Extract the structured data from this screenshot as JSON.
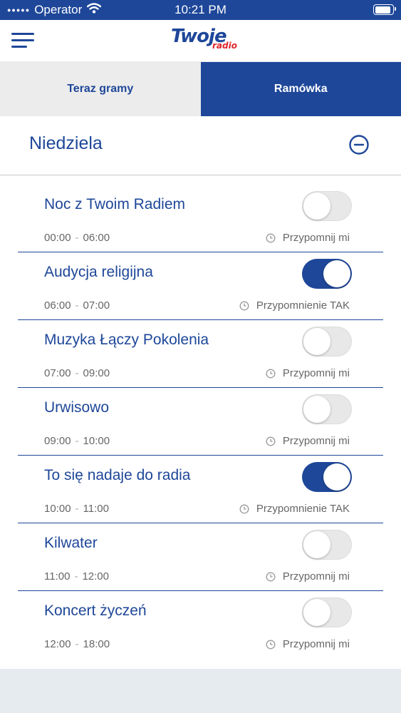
{
  "status_bar": {
    "carrier": "Operator",
    "time": "10:21 PM"
  },
  "header": {
    "logo_main": "Twoje",
    "logo_sub": "radio"
  },
  "tabs": [
    {
      "label": "Teraz gramy",
      "active": false
    },
    {
      "label": "Ramówka",
      "active": true
    }
  ],
  "day": {
    "title": "Niedziela"
  },
  "programs": [
    {
      "title": "Noc z Twoim Radiem",
      "start": "00:00",
      "end": "06:00",
      "reminder_on": false,
      "reminder_label": "Przypomnij mi"
    },
    {
      "title": "Audycja religijna",
      "start": "06:00",
      "end": "07:00",
      "reminder_on": true,
      "reminder_label": "Przypomnienie TAK"
    },
    {
      "title": "Muzyka Łączy Pokolenia",
      "start": "07:00",
      "end": "09:00",
      "reminder_on": false,
      "reminder_label": "Przypomnij mi"
    },
    {
      "title": "Urwisowo",
      "start": "09:00",
      "end": "10:00",
      "reminder_on": false,
      "reminder_label": "Przypomnij mi"
    },
    {
      "title": "To się nadaje do radia",
      "start": "10:00",
      "end": "11:00",
      "reminder_on": true,
      "reminder_label": "Przypomnienie TAK"
    },
    {
      "title": "Kilwater",
      "start": "11:00",
      "end": "12:00",
      "reminder_on": false,
      "reminder_label": "Przypomnij mi"
    },
    {
      "title": "Koncert życzeń",
      "start": "12:00",
      "end": "18:00",
      "reminder_on": false,
      "reminder_label": "Przypomnij mi"
    }
  ],
  "colors": {
    "brand_blue": "#1e4799",
    "logo_red": "#e2232a",
    "tab_inactive_bg": "#ececec",
    "footer_bg": "#e6ebf0"
  },
  "icons": {
    "menu": "hamburger-icon",
    "wifi": "wifi-icon",
    "battery": "battery-icon",
    "collapse": "minus-circle-icon",
    "reminder": "clock-icon"
  }
}
